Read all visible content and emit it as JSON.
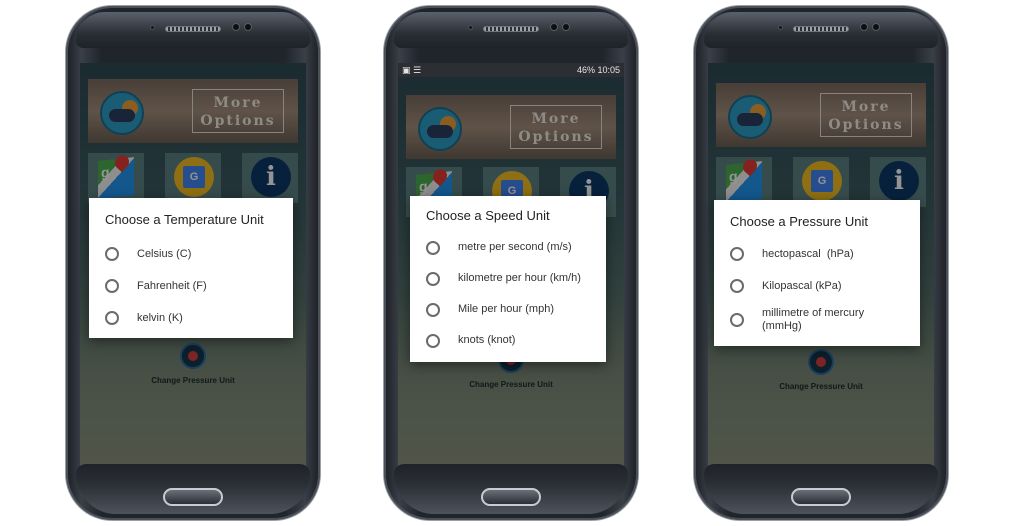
{
  "background_overlay": "#000000",
  "app": {
    "more_options_line1": "More",
    "more_options_line2": "Options",
    "pressure_button_label": "Change Pressure Unit",
    "info_glyph": "i",
    "maps_glyph": "g",
    "translate_glyph": "G"
  },
  "phones": [
    {
      "dialog": {
        "title": "Choose a Temperature Unit",
        "options": [
          "Celsius (C)",
          "Fahrenheit (F)",
          "kelvin (K)"
        ]
      }
    },
    {
      "statusbar": {
        "right": "46% 10:05"
      },
      "dialog": {
        "title": "Choose a Speed Unit",
        "options": [
          "metre per second (m/s)",
          "kilometre per hour (km/h)",
          "Mile per hour (mph)",
          "knots (knot)"
        ]
      }
    },
    {
      "dialog": {
        "title": "Choose a Pressure Unit",
        "options": [
          "hectopascal  (hPa)",
          "Kilopascal (kPa)",
          "millimetre of mercury (mmHg)"
        ]
      }
    }
  ]
}
